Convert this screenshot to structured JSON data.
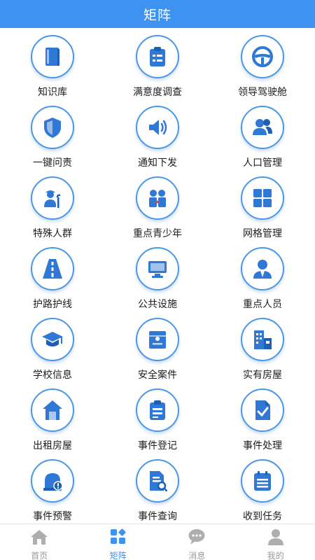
{
  "header": {
    "title": "矩阵"
  },
  "colors": {
    "accent": "#3f93f0",
    "icon": "#2f78d6",
    "inactive": "#aeaeae"
  },
  "grid": [
    {
      "label": "知识库",
      "icon": "book-icon"
    },
    {
      "label": "满意度调查",
      "icon": "clipboard-icon"
    },
    {
      "label": "领导驾驶舱",
      "icon": "steering-wheel-icon"
    },
    {
      "label": "一键问责",
      "icon": "shield-icon"
    },
    {
      "label": "通知下发",
      "icon": "speaker-icon"
    },
    {
      "label": "人口管理",
      "icon": "users-icon"
    },
    {
      "label": "特殊人群",
      "icon": "elderly-icon"
    },
    {
      "label": "重点青少年",
      "icon": "teens-icon"
    },
    {
      "label": "网格管理",
      "icon": "grid-icon"
    },
    {
      "label": "护路护线",
      "icon": "road-icon"
    },
    {
      "label": "公共设施",
      "icon": "monitor-icon"
    },
    {
      "label": "重点人员",
      "icon": "person-suit-icon"
    },
    {
      "label": "学校信息",
      "icon": "graduation-cap-icon"
    },
    {
      "label": "安全案件",
      "icon": "case-box-icon"
    },
    {
      "label": "实有房屋",
      "icon": "building-icon"
    },
    {
      "label": "出租房屋",
      "icon": "house-icon"
    },
    {
      "label": "事件登记",
      "icon": "register-clipboard-icon"
    },
    {
      "label": "事件处理",
      "icon": "document-check-icon"
    },
    {
      "label": "事件预警",
      "icon": "alarm-icon"
    },
    {
      "label": "事件查询",
      "icon": "document-search-icon"
    },
    {
      "label": "收到任务",
      "icon": "calendar-list-icon"
    }
  ],
  "tabbar": [
    {
      "label": "首页",
      "icon": "home-icon",
      "active": false
    },
    {
      "label": "矩阵",
      "icon": "matrix-icon",
      "active": true
    },
    {
      "label": "消息",
      "icon": "message-icon",
      "active": false
    },
    {
      "label": "我的",
      "icon": "profile-icon",
      "active": false
    }
  ]
}
